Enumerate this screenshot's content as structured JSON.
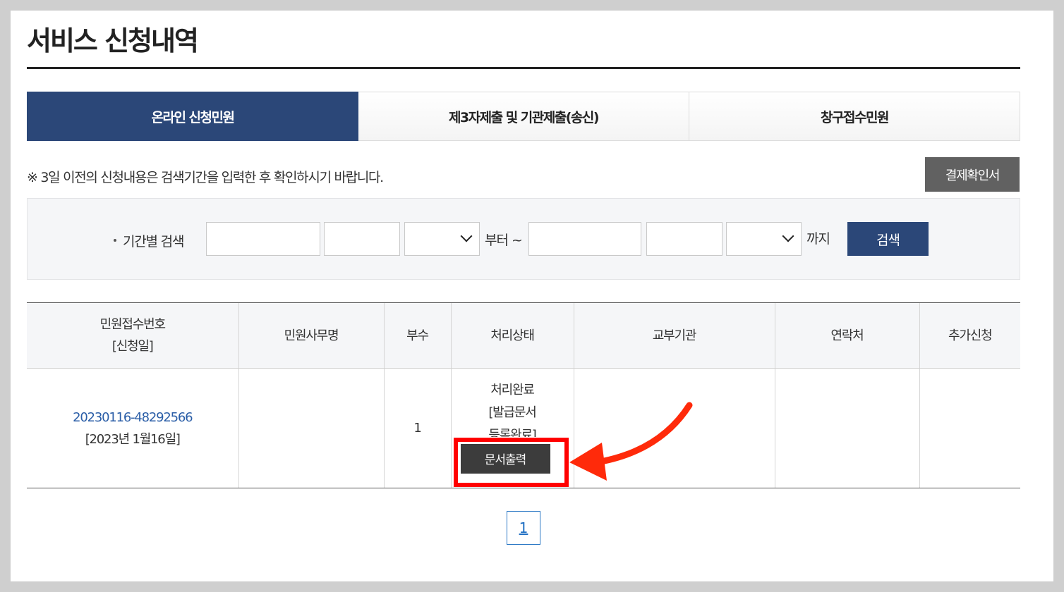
{
  "page": {
    "title": "서비스 신청내역"
  },
  "tabs": [
    {
      "label": "온라인 신청민원",
      "active": true
    },
    {
      "label": "제3자제출 및 기관제출(송신)",
      "active": false
    },
    {
      "label": "창구접수민원",
      "active": false
    }
  ],
  "notice": "※ 3일 이전의 신청내용은 검색기간을 입력한 후 확인하시기 바랍니다.",
  "receipt_button": "결제확인서",
  "search": {
    "label": "기간별 검색",
    "from_word": "부터 ~",
    "to_word": "까지",
    "button": "검색",
    "from": {
      "year": "",
      "month": "",
      "day": ""
    },
    "to": {
      "year": "",
      "month": "",
      "day": ""
    }
  },
  "table": {
    "headers": [
      "민원접수번호\n[신청일]",
      "민원사무명",
      "부수",
      "처리상태",
      "교부기관",
      "연락처",
      "추가신청"
    ],
    "header_line1": "민원접수번호",
    "header_line2": "[신청일]",
    "rows": [
      {
        "receipt_no": "20230116-48292566",
        "applied_date": "[2023년 1월16일]",
        "service_name": "",
        "copies": "1",
        "status_line1": "처리완료",
        "status_line2": "[발급문서",
        "status_line3": "등록완료]",
        "print_button": "문서출력",
        "issuing_agency": "",
        "contact": "",
        "additional": ""
      }
    ]
  },
  "pagination": {
    "current": "1"
  },
  "colors": {
    "primary": "#2b4778",
    "highlight": "#ff0000",
    "link": "#2b5ea7"
  }
}
